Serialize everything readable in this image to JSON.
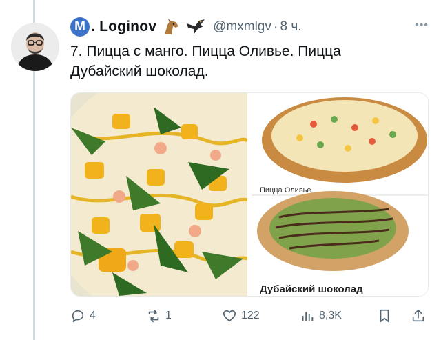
{
  "author": {
    "badge_letter": "M",
    "name": ". Loginov",
    "handle": "@mxmlgv",
    "time": "8 ч.",
    "emoji_icons": [
      "horse-head-icon",
      "eagle-icon"
    ]
  },
  "post": {
    "text_line1": "7. Пицца с манго. Пицца Оливье. Пицца",
    "text_line2": "Дубайский шоколад.",
    "images": {
      "top_right_caption": "Пицца Оливье",
      "bottom_right_caption": "Дубайский шоколад"
    }
  },
  "actions": {
    "replies": "4",
    "reposts": "1",
    "likes": "122",
    "views": "8,3K"
  },
  "colors": {
    "accent": "#1d9bf0",
    "muted": "#536471",
    "badge": "#3a73c9"
  }
}
